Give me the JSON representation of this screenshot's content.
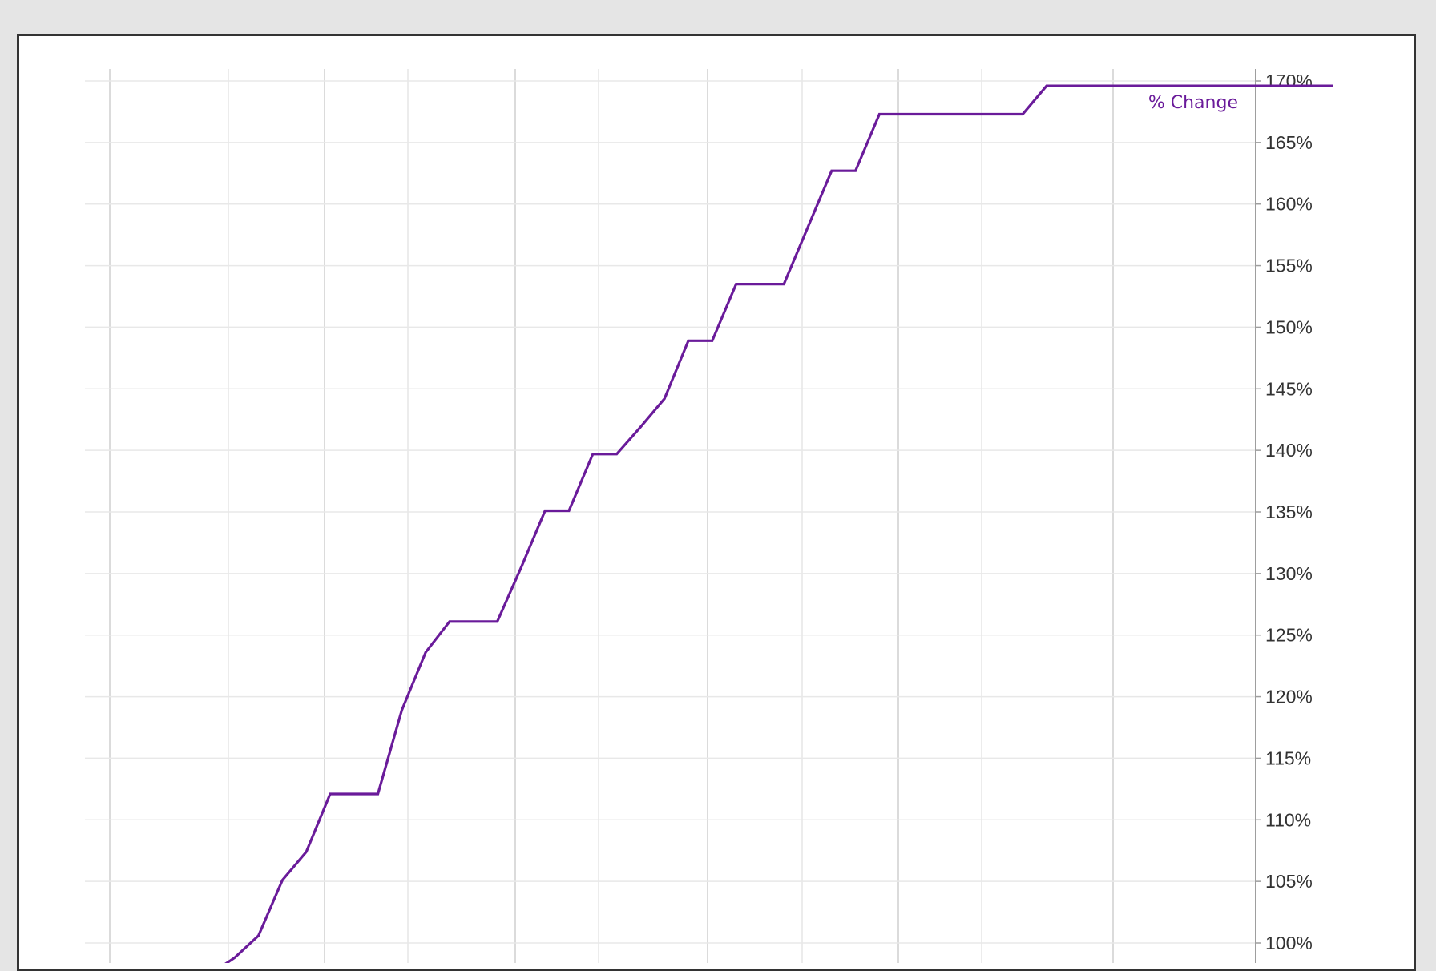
{
  "chart_data": {
    "type": "line",
    "title": "",
    "xlabel": "",
    "ylabel": "",
    "ylim": [
      100,
      170
    ],
    "yticks": [
      "100%",
      "105%",
      "110%",
      "115%",
      "120%",
      "125%",
      "130%",
      "135%",
      "140%",
      "145%",
      "150%",
      "155%",
      "160%",
      "165%",
      "170%"
    ],
    "grid": true,
    "y_axis_side": "right",
    "series": [
      {
        "name": "% Change",
        "color": "#6a1b9a",
        "label_position": "top-right",
        "x": [
          0,
          1,
          2,
          3,
          4,
          5,
          6,
          7,
          8,
          9,
          10,
          11,
          12,
          13,
          14,
          15,
          16,
          17,
          18,
          19,
          20,
          21,
          22,
          23,
          24,
          25,
          26,
          27,
          28,
          29,
          30,
          31,
          32,
          33,
          34,
          35,
          36,
          37,
          38,
          39,
          40,
          41,
          42,
          43,
          44,
          45,
          46,
          47
        ],
        "values": [
          97.5,
          98.8,
          100.6,
          105.1,
          107.4,
          112.1,
          112.1,
          112.1,
          118.9,
          123.6,
          126.1,
          126.1,
          126.1,
          130.5,
          135.1,
          135.1,
          139.7,
          139.7,
          141.9,
          144.2,
          148.9,
          148.9,
          153.5,
          153.5,
          153.5,
          158.1,
          162.7,
          162.7,
          167.3,
          167.3,
          167.3,
          167.3,
          167.3,
          167.3,
          167.3,
          169.6,
          169.6,
          169.6,
          169.6,
          169.6,
          169.6,
          169.6,
          169.6,
          169.6,
          169.6,
          169.6,
          169.6,
          169.6
        ]
      }
    ]
  }
}
